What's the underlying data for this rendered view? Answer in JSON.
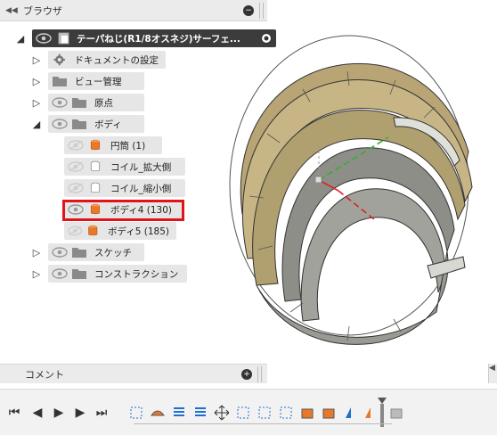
{
  "browser": {
    "title": "ブラウザ",
    "collapse_icon": "double-left-arrow-icon",
    "root": {
      "label": "テーパねじ(R1/8オスネジ)サーフェ...",
      "radio": "active-radio-icon"
    },
    "items": [
      {
        "label": "ドキュメントの設定",
        "icon": "gear-icon"
      },
      {
        "label": "ビュー管理",
        "icon": "folder-icon"
      },
      {
        "label": "原点",
        "icon": "folder-icon"
      },
      {
        "label": "ボディ",
        "icon": "folder-icon"
      },
      {
        "label": "円筒 (1)",
        "icon": "body-icon"
      },
      {
        "label": "コイル_拡大側",
        "icon": "body-icon"
      },
      {
        "label": "コイル_縮小側",
        "icon": "body-icon"
      },
      {
        "label": "ボディ4 (130)",
        "icon": "body-icon"
      },
      {
        "label": "ボディ5 (185)",
        "icon": "body-icon"
      },
      {
        "label": "スケッチ",
        "icon": "folder-icon"
      },
      {
        "label": "コンストラクション",
        "icon": "folder-icon"
      }
    ]
  },
  "comments": {
    "title": "コメント"
  },
  "colors": {
    "body_orange": "#e8792b",
    "selection_red": "#e0141a",
    "thread_tan": "#b8a474",
    "axis_green": "#2bb32b",
    "axis_red": "#e02020"
  }
}
